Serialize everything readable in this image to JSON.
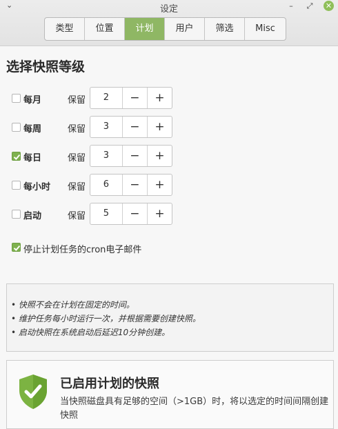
{
  "window": {
    "title": "设定"
  },
  "tabs": [
    {
      "label": "类型"
    },
    {
      "label": "位置"
    },
    {
      "label": "计划",
      "active": true
    },
    {
      "label": "用户"
    },
    {
      "label": "筛选"
    },
    {
      "label": "Misc"
    }
  ],
  "section_title": "选择快照等级",
  "schedule": [
    {
      "label": "每月",
      "checked": false,
      "keep_label": "保留",
      "value": "2"
    },
    {
      "label": "每周",
      "checked": false,
      "keep_label": "保留",
      "value": "3"
    },
    {
      "label": "每日",
      "checked": true,
      "keep_label": "保留",
      "value": "3"
    },
    {
      "label": "每小时",
      "checked": false,
      "keep_label": "保留",
      "value": "6"
    },
    {
      "label": "启动",
      "checked": false,
      "keep_label": "保留",
      "value": "5"
    }
  ],
  "spin_labels": {
    "minus": "−",
    "plus": "+"
  },
  "cron": {
    "label": "停止计划任务的cron电子邮件",
    "checked": true
  },
  "info_lines": [
    "• 快照不会在计划在固定的时间。",
    "• 维护任务每小时运行一次，并根据需要创建快照。",
    "• 启动快照在系统启动后延迟10分钟创建。"
  ],
  "status": {
    "title": "已启用计划的快照",
    "description": "当快照磁盘具有足够的空间（>1GB）时，将以选定的时间间隔创建快照",
    "icon": "shield-check-icon"
  },
  "colors": {
    "accent": "#8fb764",
    "check": "#7fb14f",
    "shield": "#7cb342"
  }
}
